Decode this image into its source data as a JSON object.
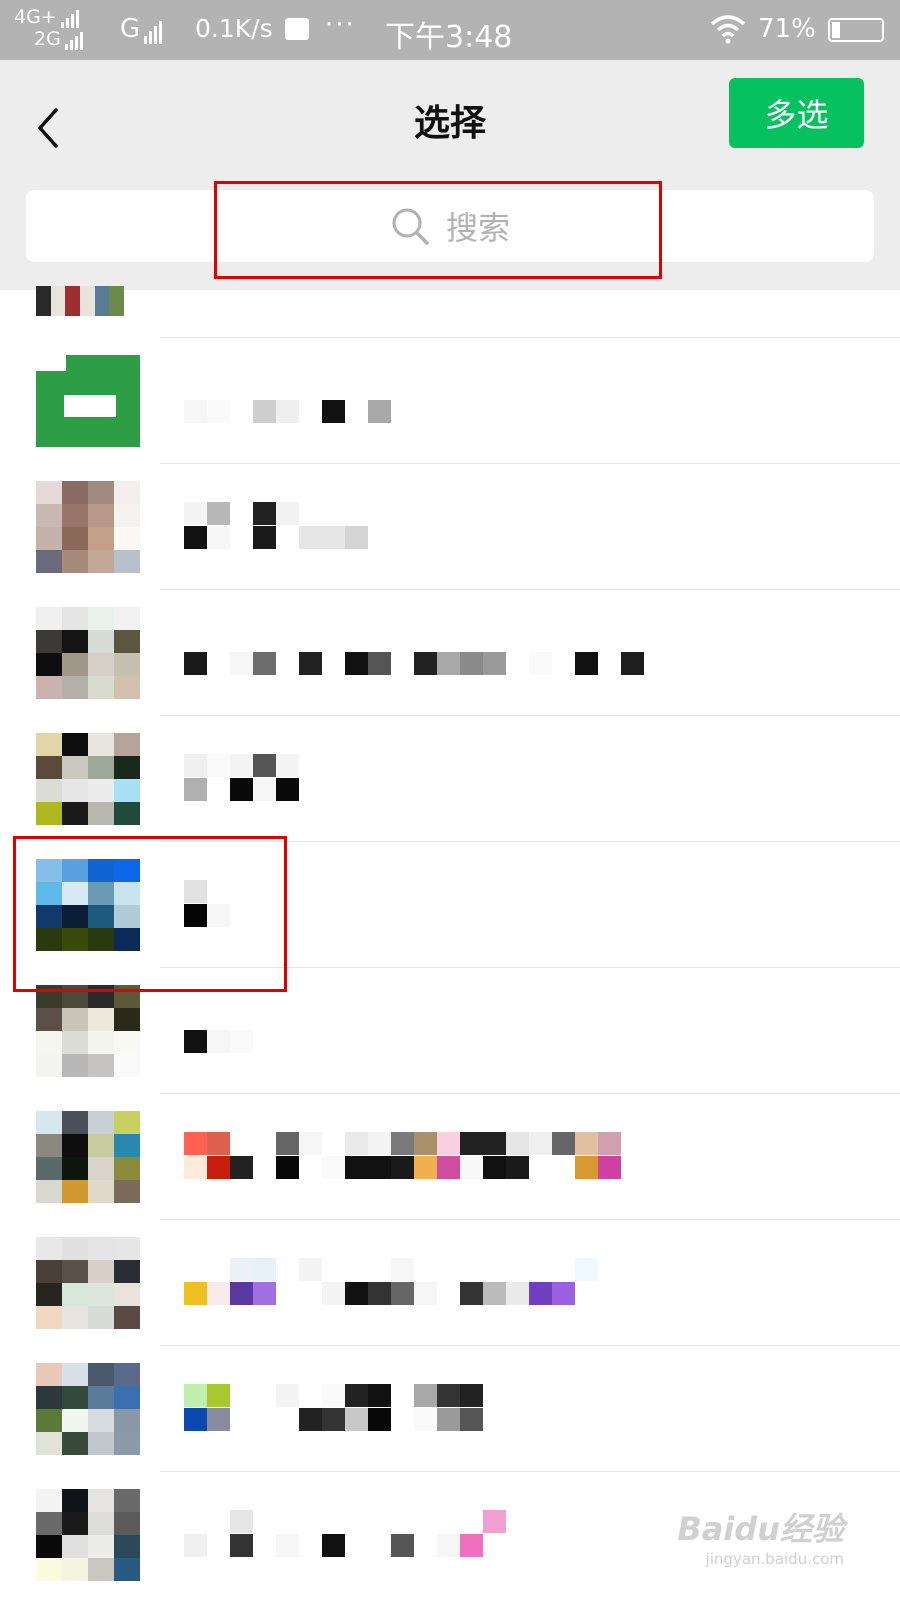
{
  "status_bar": {
    "network1": "4G+",
    "network2": "2G",
    "network3": "G",
    "speed": "0.1K/s",
    "dots": "···",
    "time": "下午3:48",
    "battery": "71%"
  },
  "header": {
    "title": "选择",
    "multi_select_label": "多选"
  },
  "search": {
    "placeholder": "搜索"
  },
  "colors": {
    "accent": "#07c160",
    "highlight": "#e00000",
    "header_bg": "#ededed",
    "status_bar_bg": "#b3b3b3"
  },
  "icons": {
    "back": "chevron-left-icon",
    "search": "search-icon",
    "wifi": "wifi-icon",
    "battery": "battery-icon"
  },
  "watermark": {
    "brand": "Baidu经验",
    "url": "jingyan.baidu.com"
  }
}
